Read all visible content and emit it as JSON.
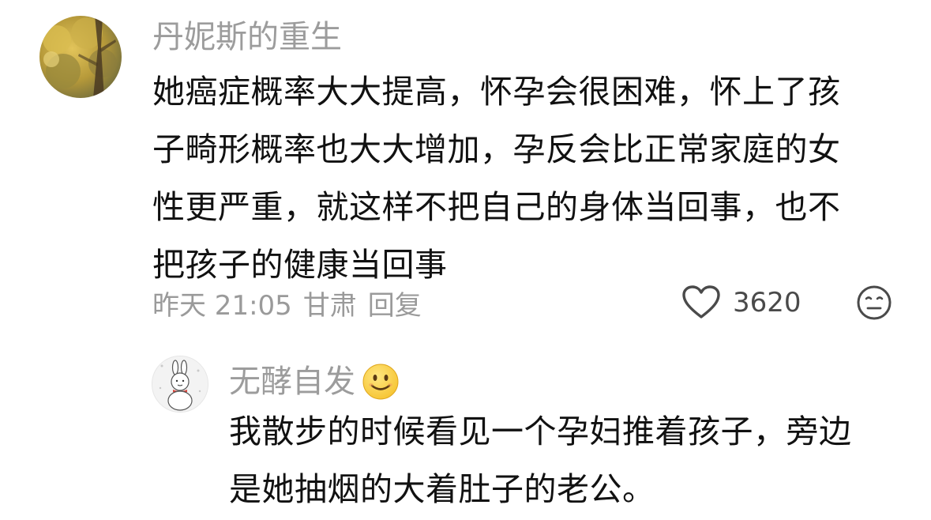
{
  "main_comment": {
    "username": "丹妮斯的重生",
    "lines": [
      "她癌症概率大大提高，怀孕会很困难，怀上了孩",
      "子畸形概率也大大增加，孕反会比正常家庭的女",
      "性更严重，就这样不把自己的身体当回事，也不",
      "把孩子的健康当回事"
    ],
    "time": "昨天 21:05",
    "location": "甘肃",
    "reply_label": "回复",
    "like_count": "3620",
    "avatar_icon": "ginkgo-tree-photo",
    "like_icon": "heart-icon",
    "reaction_icon": "neutral-face-icon"
  },
  "reply_comment": {
    "username": "无酵自发",
    "username_emoji": "smiling-face-emoji",
    "lines": [
      "我散步的时候看见一个孕妇推着孩子，旁边",
      "是她抽烟的大着肚子的老公。"
    ],
    "avatar_icon": "bunny-snowman-avatar"
  },
  "colors": {
    "username": "#9c9c9c",
    "text": "#111111",
    "meta": "#9a9a9a",
    "emoji_yellow": "#f6c431"
  }
}
